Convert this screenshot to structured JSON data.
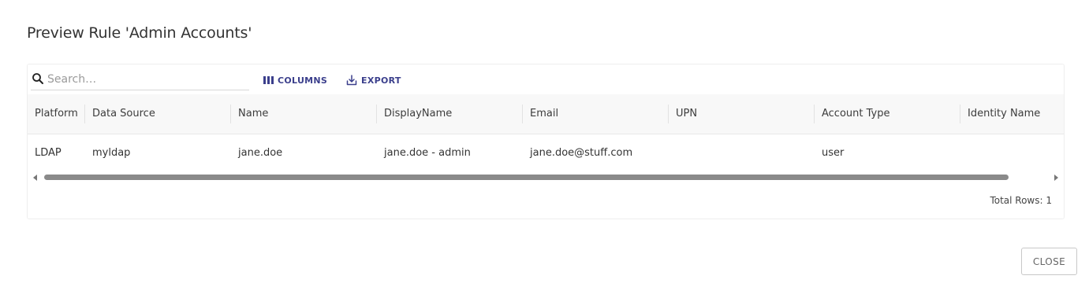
{
  "dialog": {
    "title": "Preview Rule 'Admin Accounts'",
    "close_label": "CLOSE"
  },
  "toolbar": {
    "search_placeholder": "Search…",
    "search_value": "",
    "columns_label": "COLUMNS",
    "export_label": "EXPORT",
    "columns_icon": "columns-icon",
    "export_icon": "export-icon",
    "search_icon": "search-icon",
    "accent_color": "#3b3f8c"
  },
  "table": {
    "columns": [
      "Platform",
      "Data Source",
      "Name",
      "DisplayName",
      "Email",
      "UPN",
      "Account Type",
      "Identity Name"
    ],
    "rows": [
      [
        "LDAP",
        "myldap",
        "jane.doe",
        "jane.doe - admin",
        "jane.doe@stuff.com",
        "",
        "user",
        ""
      ]
    ]
  },
  "footer": {
    "total_rows": "Total Rows: 1"
  }
}
